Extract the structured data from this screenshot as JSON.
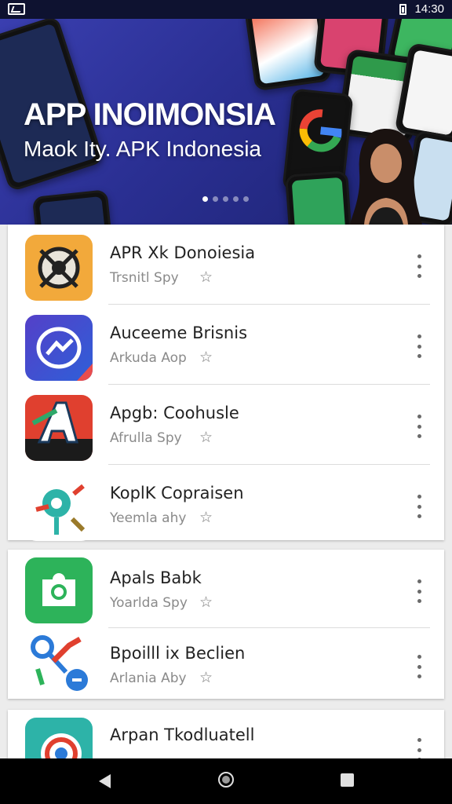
{
  "status_bar": {
    "time": "14:30"
  },
  "banner": {
    "title": "APP INOIMONSIA",
    "subtitle": "Maok Ity. APK Indonesia",
    "dots": 5,
    "active_dot": 0
  },
  "cards": [
    {
      "rows": [
        {
          "title": "APR Xk Donoiesia",
          "subtitle": "Trsnitl Spy",
          "icon": "eye-app-icon"
        },
        {
          "title": "Auceeme Brisnis",
          "subtitle": "Arkuda Aop",
          "icon": "messenger-app-icon"
        },
        {
          "title": "Apgb: Coohusle",
          "subtitle": "Afrulla Spy",
          "icon": "letter-a-app-icon"
        },
        {
          "title": "KoplK Copraisen",
          "subtitle": "Yeemla ahy",
          "icon": "location-pin-app-icon"
        }
      ]
    },
    {
      "rows": [
        {
          "title": "Apals Babk",
          "subtitle": "Yoarlda Spy",
          "icon": "green-puzzle-app-icon"
        },
        {
          "title": "Bpoilll ix Beclien",
          "subtitle": "Arlania Aby",
          "icon": "tools-app-icon"
        }
      ]
    },
    {
      "rows": [
        {
          "title": "Arpan Tkodluatell",
          "subtitle": "",
          "icon": "chrome-like-app-icon"
        }
      ]
    }
  ],
  "colors": {
    "banner": "#2a2f92",
    "icon_orange": "#f2a93b",
    "icon_purple": "#5440c8",
    "icon_red": "#e0402f",
    "icon_green": "#2db35a"
  }
}
